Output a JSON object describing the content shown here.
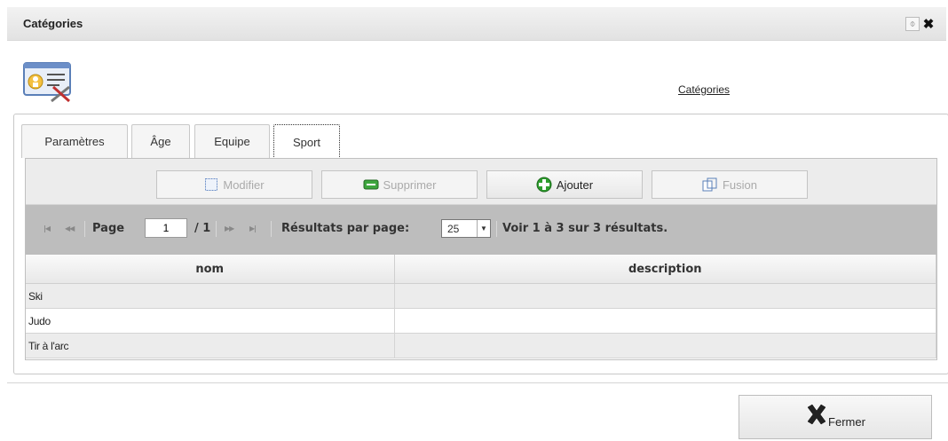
{
  "window": {
    "title": "Catégories",
    "pin_glyph": "⌽",
    "close_glyph": "✖"
  },
  "header": {
    "link": "Catégories"
  },
  "tabs": [
    {
      "label": "Paramètres"
    },
    {
      "label": "Âge"
    },
    {
      "label": "Equipe"
    },
    {
      "label": "Sport",
      "active": true
    }
  ],
  "toolbar": {
    "modifier": "Modifier",
    "supprimer": "Supprimer",
    "ajouter": "Ajouter",
    "fusion": "Fusion"
  },
  "pager": {
    "page_label": "Page",
    "page_value": "1",
    "total": "/ 1",
    "per_page_label": "Résultats par page:",
    "per_page_value": "25",
    "summary": "Voir 1 à 3 sur 3 résultats."
  },
  "table": {
    "columns": [
      "nom",
      "description"
    ],
    "rows": [
      {
        "nom": "Ski",
        "description": ""
      },
      {
        "nom": "Judo",
        "description": ""
      },
      {
        "nom": "Tir à l'arc",
        "description": ""
      }
    ]
  },
  "footer": {
    "close_label": "Fermer"
  },
  "colors": {
    "add_green": "#2e9e2e",
    "pager_bg": "#bdbdbd"
  }
}
